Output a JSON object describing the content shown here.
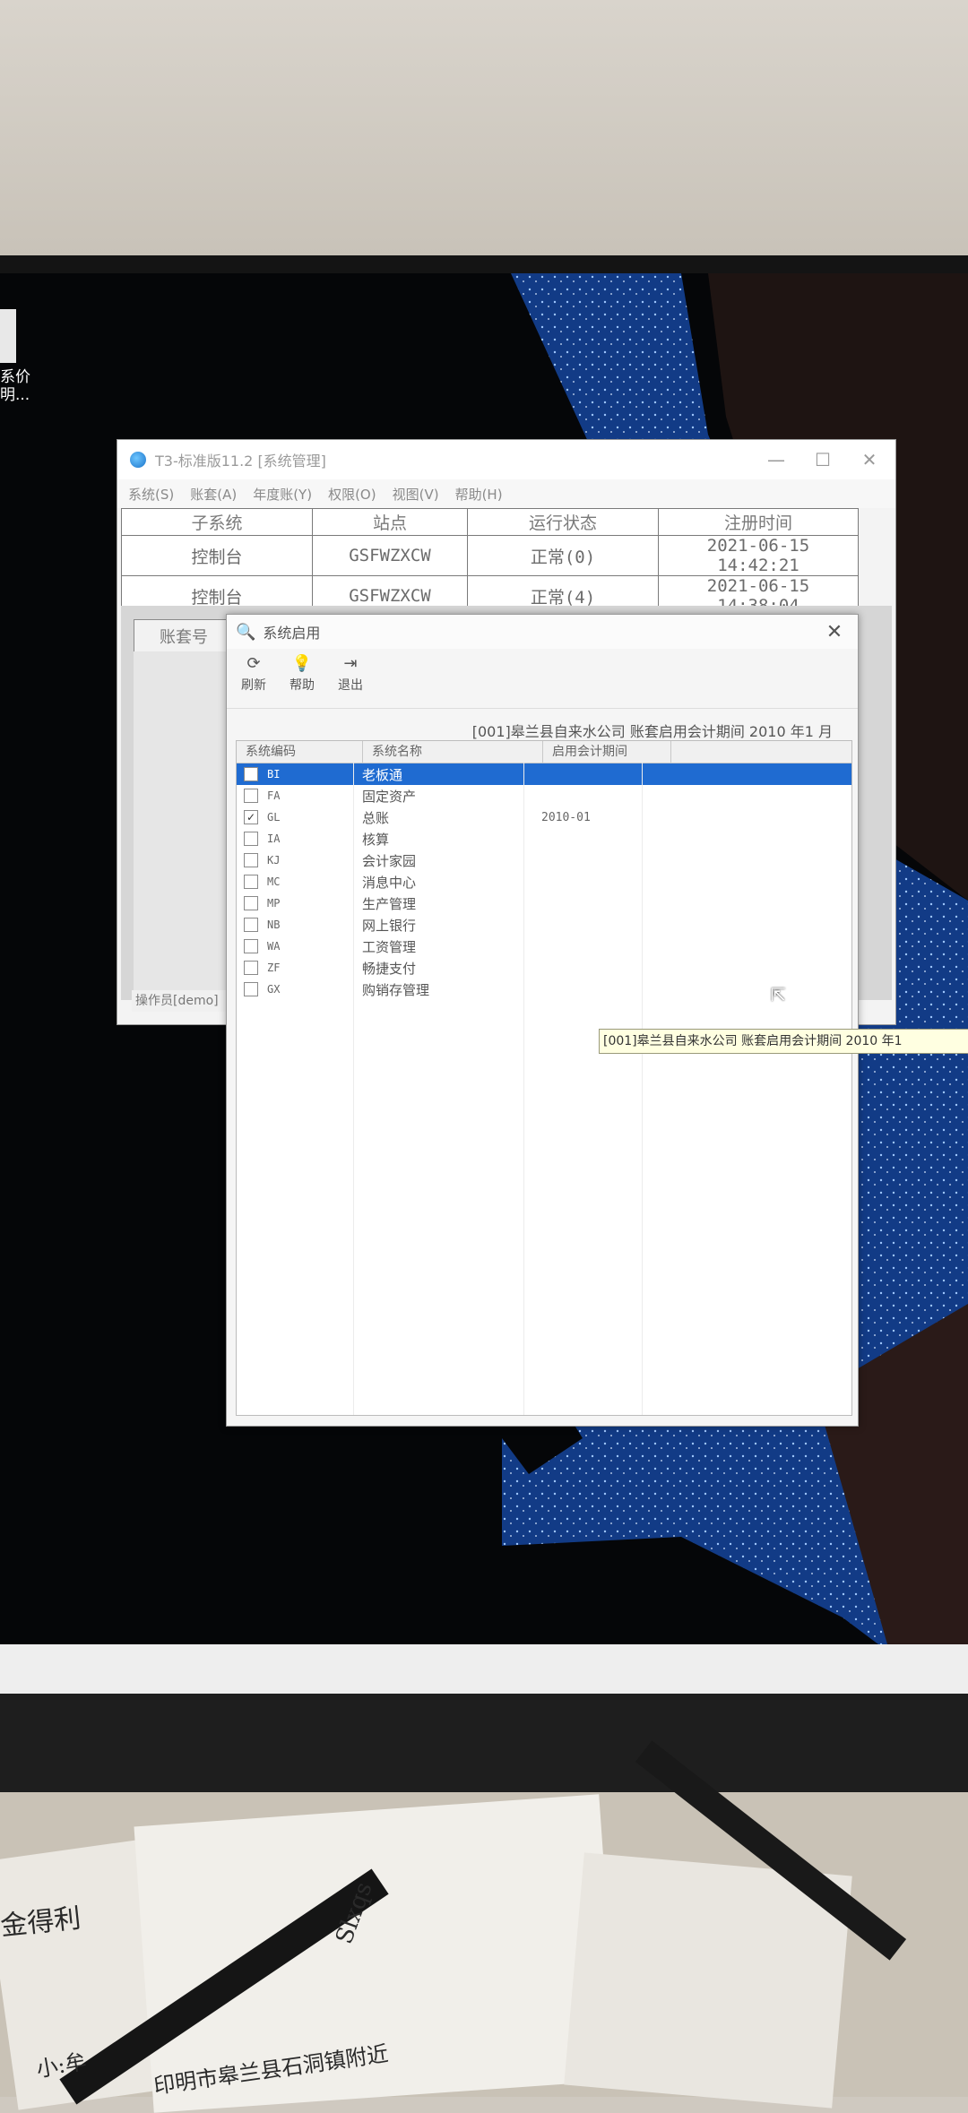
{
  "desktop": {
    "icon_label": "系价\n明..."
  },
  "main_window": {
    "title": "T3-标准版11.2 [系统管理]",
    "controls": {
      "minimize": "—",
      "maximize": "☐",
      "close": "✕"
    },
    "menus": [
      "系统(S)",
      "账套(A)",
      "年度账(Y)",
      "权限(O)",
      "视图(V)",
      "帮助(H)"
    ],
    "table": {
      "headers": [
        "子系统",
        "站点",
        "运行状态",
        "注册时间"
      ],
      "rows": [
        [
          "控制台",
          "GSFWZXCW",
          "正常(0)",
          "2021-06-15 14:42:21"
        ],
        [
          "控制台",
          "GSFWZXCW",
          "正常(4)",
          "2021-06-15 14:38:04"
        ]
      ]
    },
    "acct_column_label": "账套号",
    "status_text": "操作员[demo]"
  },
  "dialog": {
    "title": "系统启用",
    "close": "✕",
    "toolbar": [
      {
        "icon": "refresh-icon",
        "glyph": "⟳",
        "label": "刷新"
      },
      {
        "icon": "help-icon",
        "glyph": "💡",
        "label": "帮助"
      },
      {
        "icon": "exit-icon",
        "glyph": "⇥",
        "label": "退出"
      }
    ],
    "info": "[001]皋兰县自来水公司 账套启用会计期间 2010 年1 月",
    "list": {
      "headers": [
        "系统编码",
        "系统名称",
        "启用会计期间"
      ],
      "rows": [
        {
          "checked": false,
          "code": "BI",
          "name": "老板通",
          "period": "",
          "selected": true
        },
        {
          "checked": false,
          "code": "FA",
          "name": "固定资产",
          "period": ""
        },
        {
          "checked": true,
          "code": "GL",
          "name": "总账",
          "period": "2010-01"
        },
        {
          "checked": false,
          "code": "IA",
          "name": "核算",
          "period": ""
        },
        {
          "checked": false,
          "code": "KJ",
          "name": "会计家园",
          "period": ""
        },
        {
          "checked": false,
          "code": "MC",
          "name": "消息中心",
          "period": ""
        },
        {
          "checked": false,
          "code": "MP",
          "name": "生产管理",
          "period": ""
        },
        {
          "checked": false,
          "code": "NB",
          "name": "网上银行",
          "period": ""
        },
        {
          "checked": false,
          "code": "WA",
          "name": "工资管理",
          "period": ""
        },
        {
          "checked": false,
          "code": "ZF",
          "name": "畅捷支付",
          "period": ""
        },
        {
          "checked": false,
          "code": "GX",
          "name": "购销存管理",
          "period": ""
        }
      ]
    },
    "tooltip": "[001]皋兰县自来水公司 账套启用会计期间 2010 年1"
  },
  "desk_notes": {
    "note1": "金得利",
    "note2": "Slxqs",
    "note3": "小:牟",
    "note4": "印明市皋兰县石洞镇附近"
  },
  "colors": {
    "selection": "#1f6bd1",
    "tooltip_bg": "#ffffe1",
    "screen_bg": "#050608"
  }
}
